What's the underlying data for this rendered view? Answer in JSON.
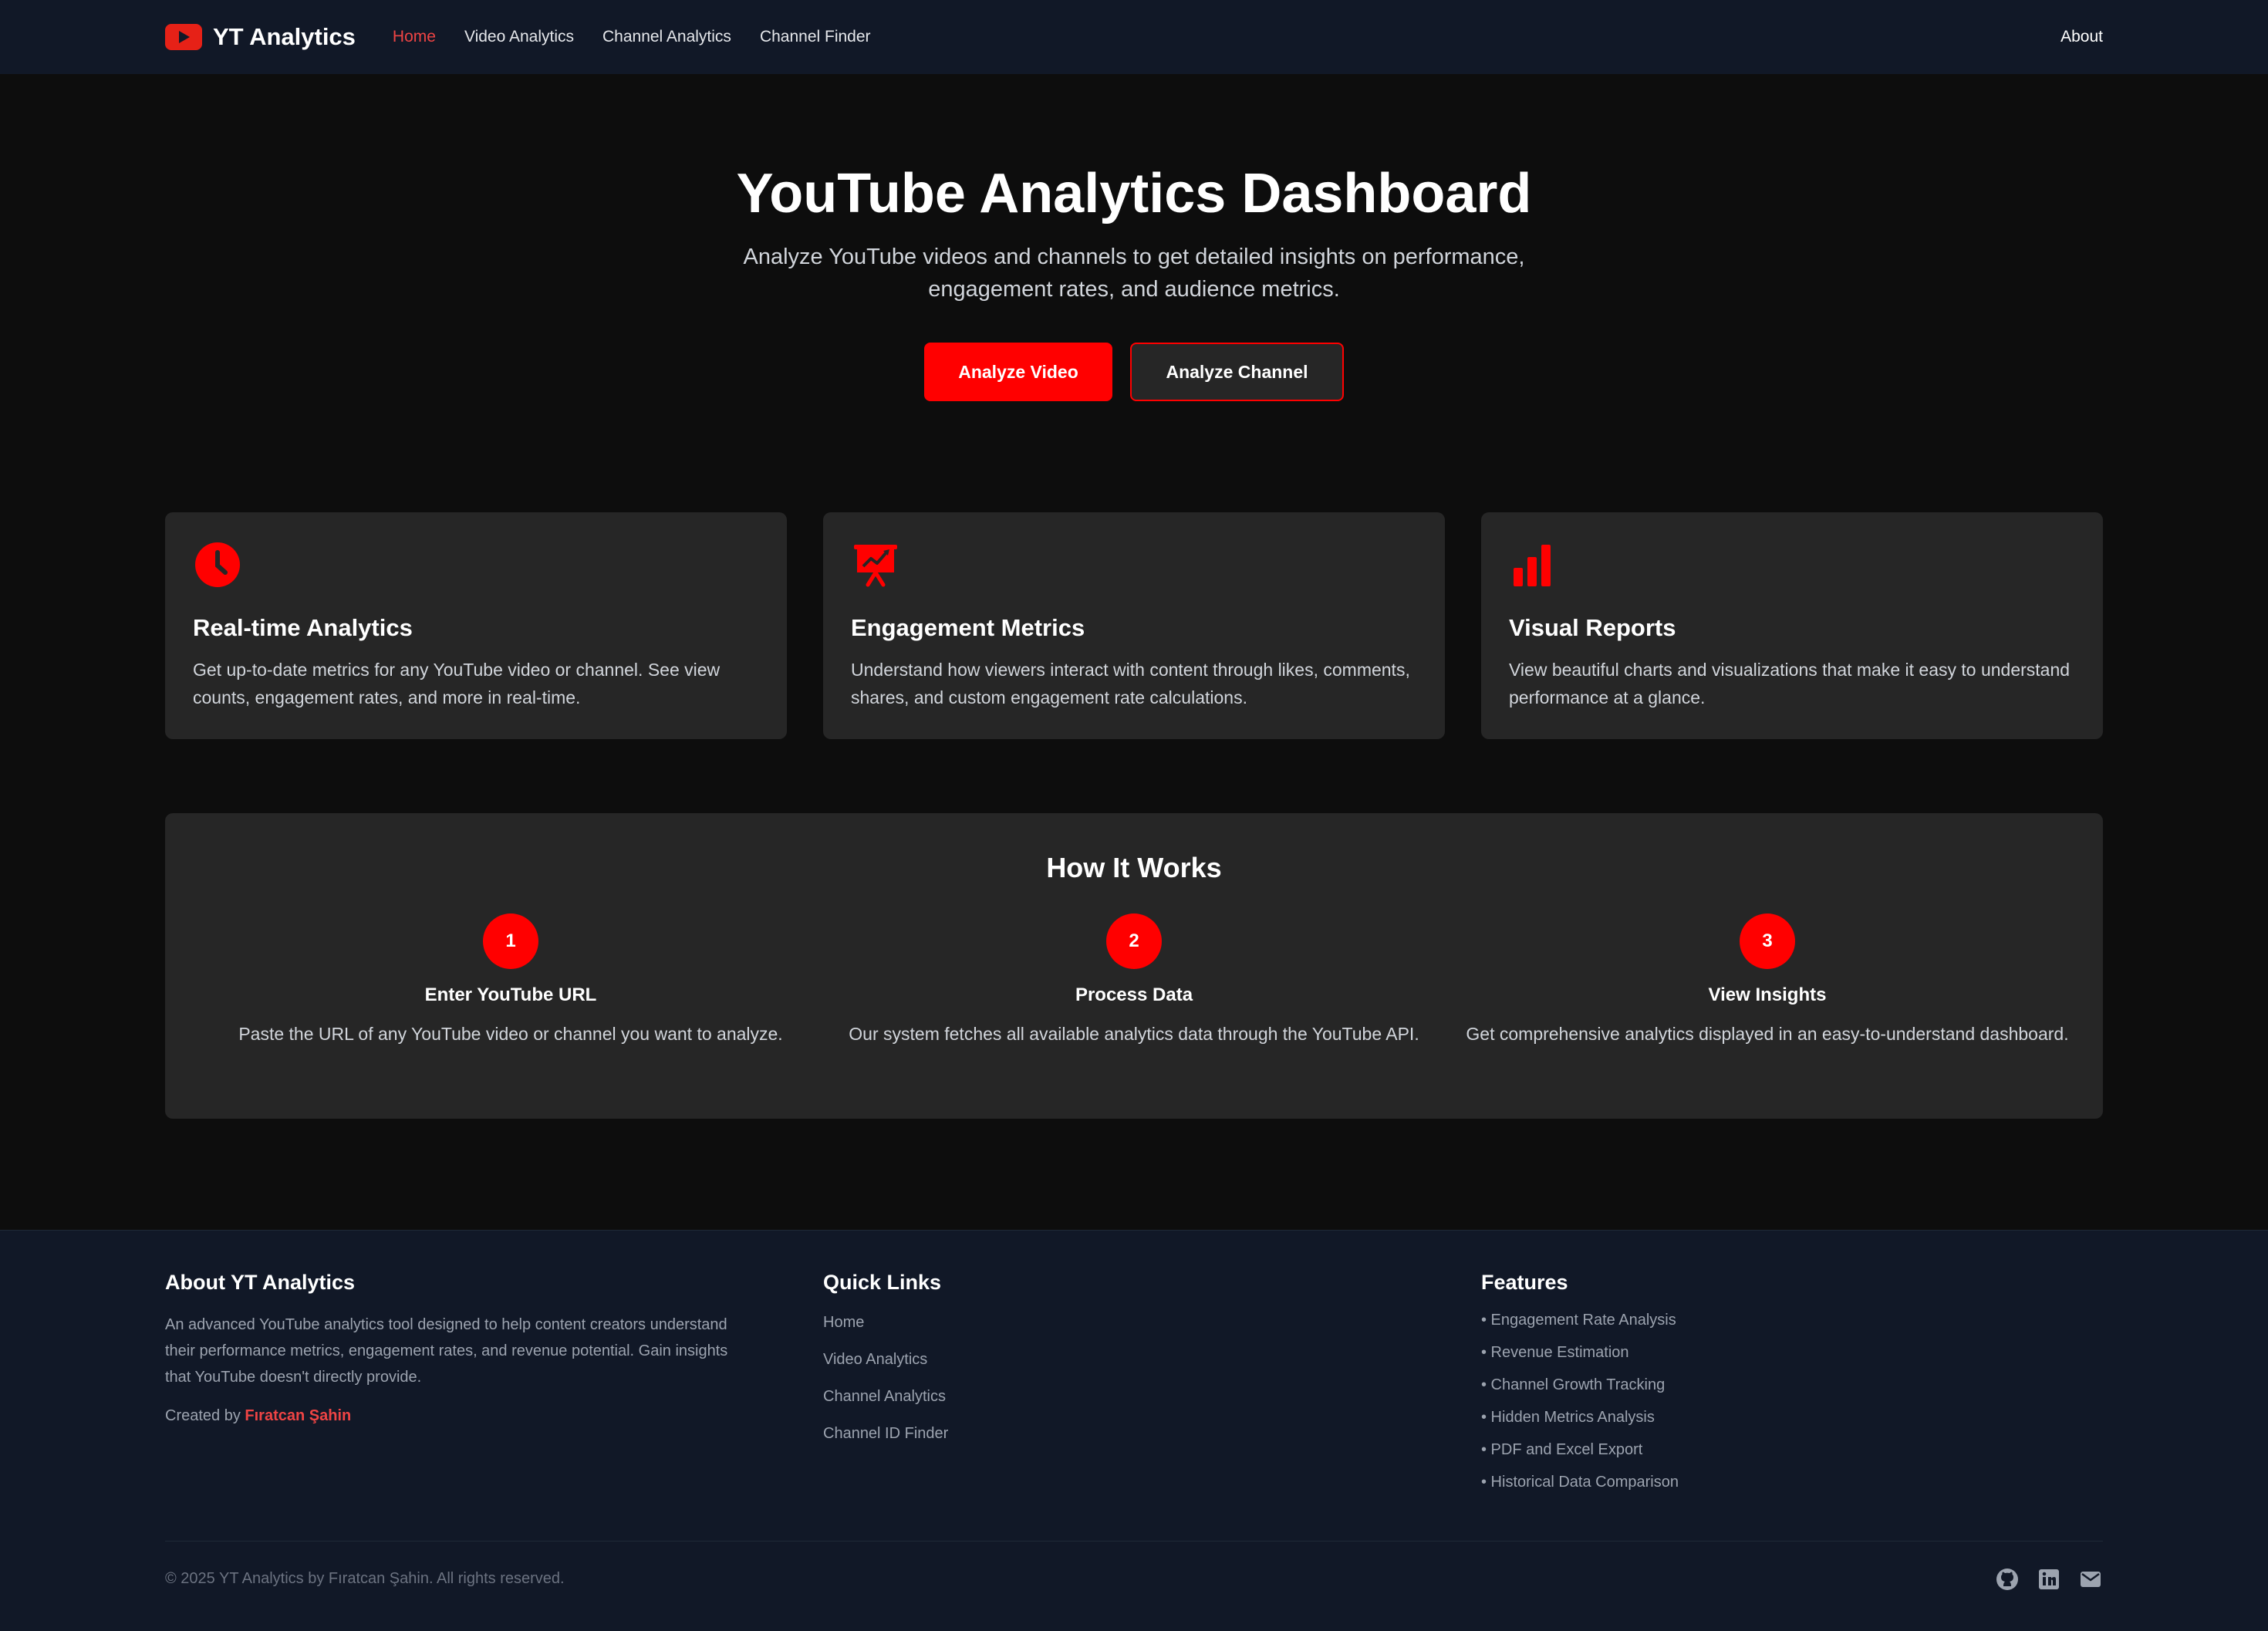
{
  "nav": {
    "brand": "YT Analytics",
    "links": [
      "Home",
      "Video Analytics",
      "Channel Analytics",
      "Channel Finder"
    ],
    "active_link": "Home",
    "about": "About"
  },
  "hero": {
    "title": "YouTube Analytics Dashboard",
    "subtitle": "Analyze YouTube videos and channels to get detailed insights on performance, engagement rates, and audience metrics.",
    "primary_button": "Analyze Video",
    "secondary_button": "Analyze Channel"
  },
  "features": [
    {
      "icon": "clock-icon",
      "title": "Real-time Analytics",
      "description": "Get up-to-date metrics for any YouTube video or channel. See view counts, engagement rates, and more in real-time."
    },
    {
      "icon": "chart-presentation-icon",
      "title": "Engagement Metrics",
      "description": "Understand how viewers interact with content through likes, comments, shares, and custom engagement rate calculations."
    },
    {
      "icon": "bar-chart-icon",
      "title": "Visual Reports",
      "description": "View beautiful charts and visualizations that make it easy to understand performance at a glance."
    }
  ],
  "how_it_works": {
    "title": "How It Works",
    "steps": [
      {
        "number": "1",
        "title": "Enter YouTube URL",
        "description": "Paste the URL of any YouTube video or channel you want to analyze."
      },
      {
        "number": "2",
        "title": "Process Data",
        "description": "Our system fetches all available analytics data through the YouTube API."
      },
      {
        "number": "3",
        "title": "View Insights",
        "description": "Get comprehensive analytics displayed in an easy-to-understand dashboard."
      }
    ]
  },
  "footer": {
    "about_title": "About YT Analytics",
    "about_text": "An advanced YouTube analytics tool designed to help content creators understand their performance metrics, engagement rates, and revenue potential. Gain insights that YouTube doesn't directly provide.",
    "created_by_label": "Created by",
    "author": "Fıratcan Şahin",
    "quick_links_title": "Quick Links",
    "quick_links": [
      "Home",
      "Video Analytics",
      "Channel Analytics",
      "Channel ID Finder"
    ],
    "features_title": "Features",
    "features_list": [
      "• Engagement Rate Analysis",
      "• Revenue Estimation",
      "• Channel Growth Tracking",
      "• Hidden Metrics Analysis",
      "• PDF and Excel Export",
      "• Historical Data Comparison"
    ],
    "copyright": "© 2025 YT Analytics by Fıratcan Şahin. All rights reserved.",
    "social_icons": [
      "github-icon",
      "linkedin-icon",
      "email-icon"
    ]
  },
  "colors": {
    "accent": "#ff0000",
    "background": "#0d0d0d",
    "navbar": "#111827",
    "card": "#262626"
  }
}
